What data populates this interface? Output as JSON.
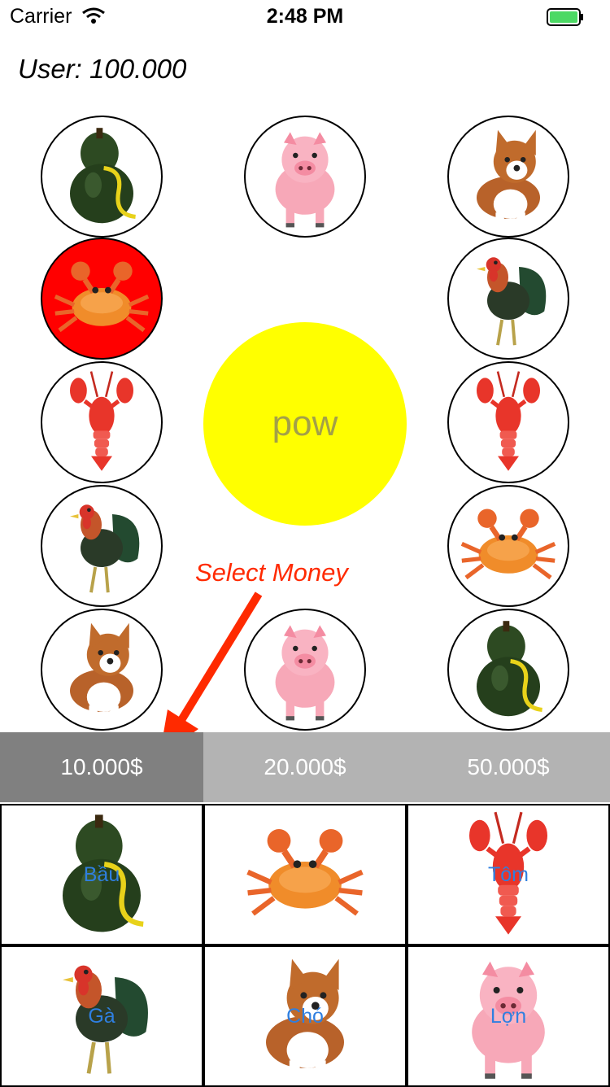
{
  "status_bar": {
    "carrier": "Carrier",
    "time": "2:48 PM"
  },
  "user": {
    "label": "User: 100.000"
  },
  "board": {
    "circles": [
      {
        "animal": "gourd"
      },
      {
        "animal": "pig"
      },
      {
        "animal": "dog"
      },
      {
        "animal": "crab",
        "selected": true
      },
      {
        "animal": "rooster"
      },
      {
        "animal": "shrimp"
      },
      {
        "animal": "shrimp"
      },
      {
        "animal": "rooster"
      },
      {
        "animal": "crab"
      },
      {
        "animal": "dog"
      },
      {
        "animal": "pig"
      },
      {
        "animal": "gourd"
      }
    ],
    "pow_label": "pow"
  },
  "annotation": {
    "text": "Select Money"
  },
  "money": {
    "options": [
      "10.000$",
      "20.000$",
      "50.000$"
    ],
    "selected_index": 0
  },
  "bets": {
    "items": [
      {
        "animal": "gourd",
        "label": "Bầu"
      },
      {
        "animal": "crab",
        "label": ""
      },
      {
        "animal": "shrimp",
        "label": "Tôm"
      },
      {
        "animal": "rooster",
        "label": "Gà"
      },
      {
        "animal": "dog",
        "label": "Chó"
      },
      {
        "animal": "pig",
        "label": "Lợn"
      }
    ]
  },
  "colors": {
    "pow": "#ffff00",
    "selected": "#ff0000",
    "annotation": "#ff2a00",
    "link": "#2f7fe0"
  }
}
